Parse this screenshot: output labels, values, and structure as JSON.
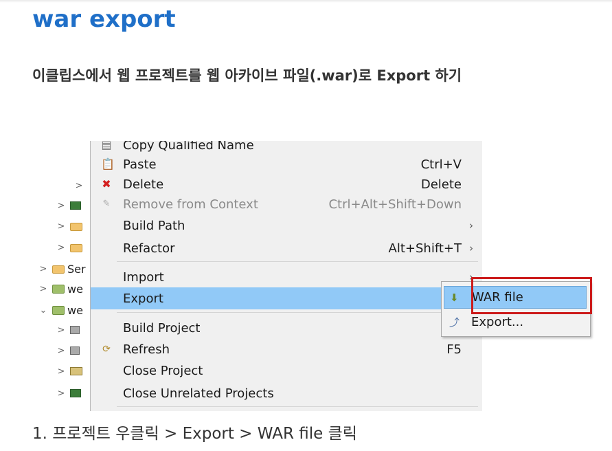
{
  "page": {
    "heading": "war export",
    "subheading": "이클립스에서 웹 프로젝트를 웹 아카이브 파일(.war)로 Export 하기",
    "caption": "1. 프로젝트 우클릭 > Export > WAR file 클릭"
  },
  "tree": {
    "rows": [
      "Ser",
      "we",
      "we"
    ]
  },
  "context_menu": {
    "items": [
      {
        "label": "Copy Qualified Name",
        "shortcut": "",
        "icon": "copy-icon"
      },
      {
        "label": "Paste",
        "shortcut": "Ctrl+V",
        "icon": "paste-icon"
      },
      {
        "label": "Delete",
        "shortcut": "Delete",
        "icon": "delete-icon"
      },
      {
        "label": "Remove from Context",
        "shortcut": "Ctrl+Alt+Shift+Down",
        "icon": "remove-context-icon"
      },
      {
        "label": "Build Path",
        "shortcut": "",
        "icon": ""
      },
      {
        "label": "Refactor",
        "shortcut": "Alt+Shift+T",
        "icon": ""
      },
      {
        "label": "Import",
        "shortcut": "",
        "icon": ""
      },
      {
        "label": "Export",
        "shortcut": "",
        "icon": ""
      },
      {
        "label": "Build Project",
        "shortcut": "",
        "icon": ""
      },
      {
        "label": "Refresh",
        "shortcut": "F5",
        "icon": "refresh-icon"
      },
      {
        "label": "Close Project",
        "shortcut": "",
        "icon": ""
      },
      {
        "label": "Close Unrelated Projects",
        "shortcut": "",
        "icon": ""
      }
    ],
    "submenu_arrow": "›"
  },
  "submenu": {
    "items": [
      {
        "label": "WAR file",
        "icon": "war-file-icon"
      },
      {
        "label": "Export...",
        "icon": "export-icon"
      }
    ]
  },
  "colors": {
    "heading": "#1f6fc8",
    "selection": "#91c9f7",
    "highlight_border": "#cc1b1b"
  }
}
